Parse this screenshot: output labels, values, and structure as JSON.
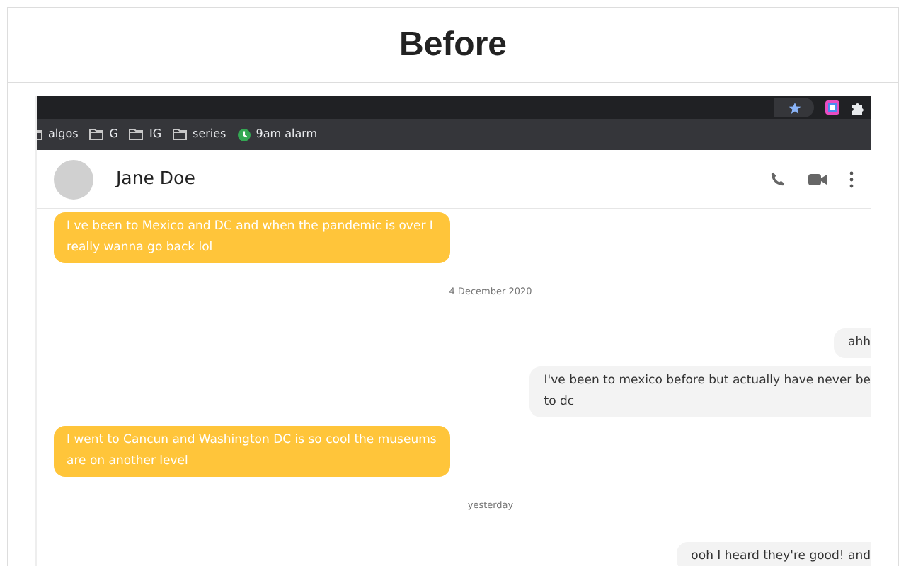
{
  "heading": "Before",
  "browser": {
    "bookmarks": [
      {
        "label": "algos",
        "kind": "folder"
      },
      {
        "label": "G",
        "kind": "folder"
      },
      {
        "label": "IG",
        "kind": "folder"
      },
      {
        "label": "series",
        "kind": "folder"
      },
      {
        "label": "9am alarm",
        "kind": "clock"
      }
    ]
  },
  "chat": {
    "contact": "Jane Doe",
    "items": [
      {
        "kind": "incoming",
        "text": "I ve been to Mexico and DC and when the pandemic is over I really wanna go back lol"
      },
      {
        "kind": "date",
        "text": "4 December 2020"
      },
      {
        "kind": "outgoing",
        "lines": [
          "ahh"
        ]
      },
      {
        "kind": "outgoing",
        "lines": [
          "I've been to mexico before but actually have never be",
          "to dc"
        ]
      },
      {
        "kind": "incoming",
        "text": "I went to Cancun and Washington DC is so cool the museums are on another level"
      },
      {
        "kind": "date",
        "text": "yesterday"
      },
      {
        "kind": "outgoing",
        "lines": [
          "ooh I heard they're good! and"
        ]
      }
    ]
  }
}
